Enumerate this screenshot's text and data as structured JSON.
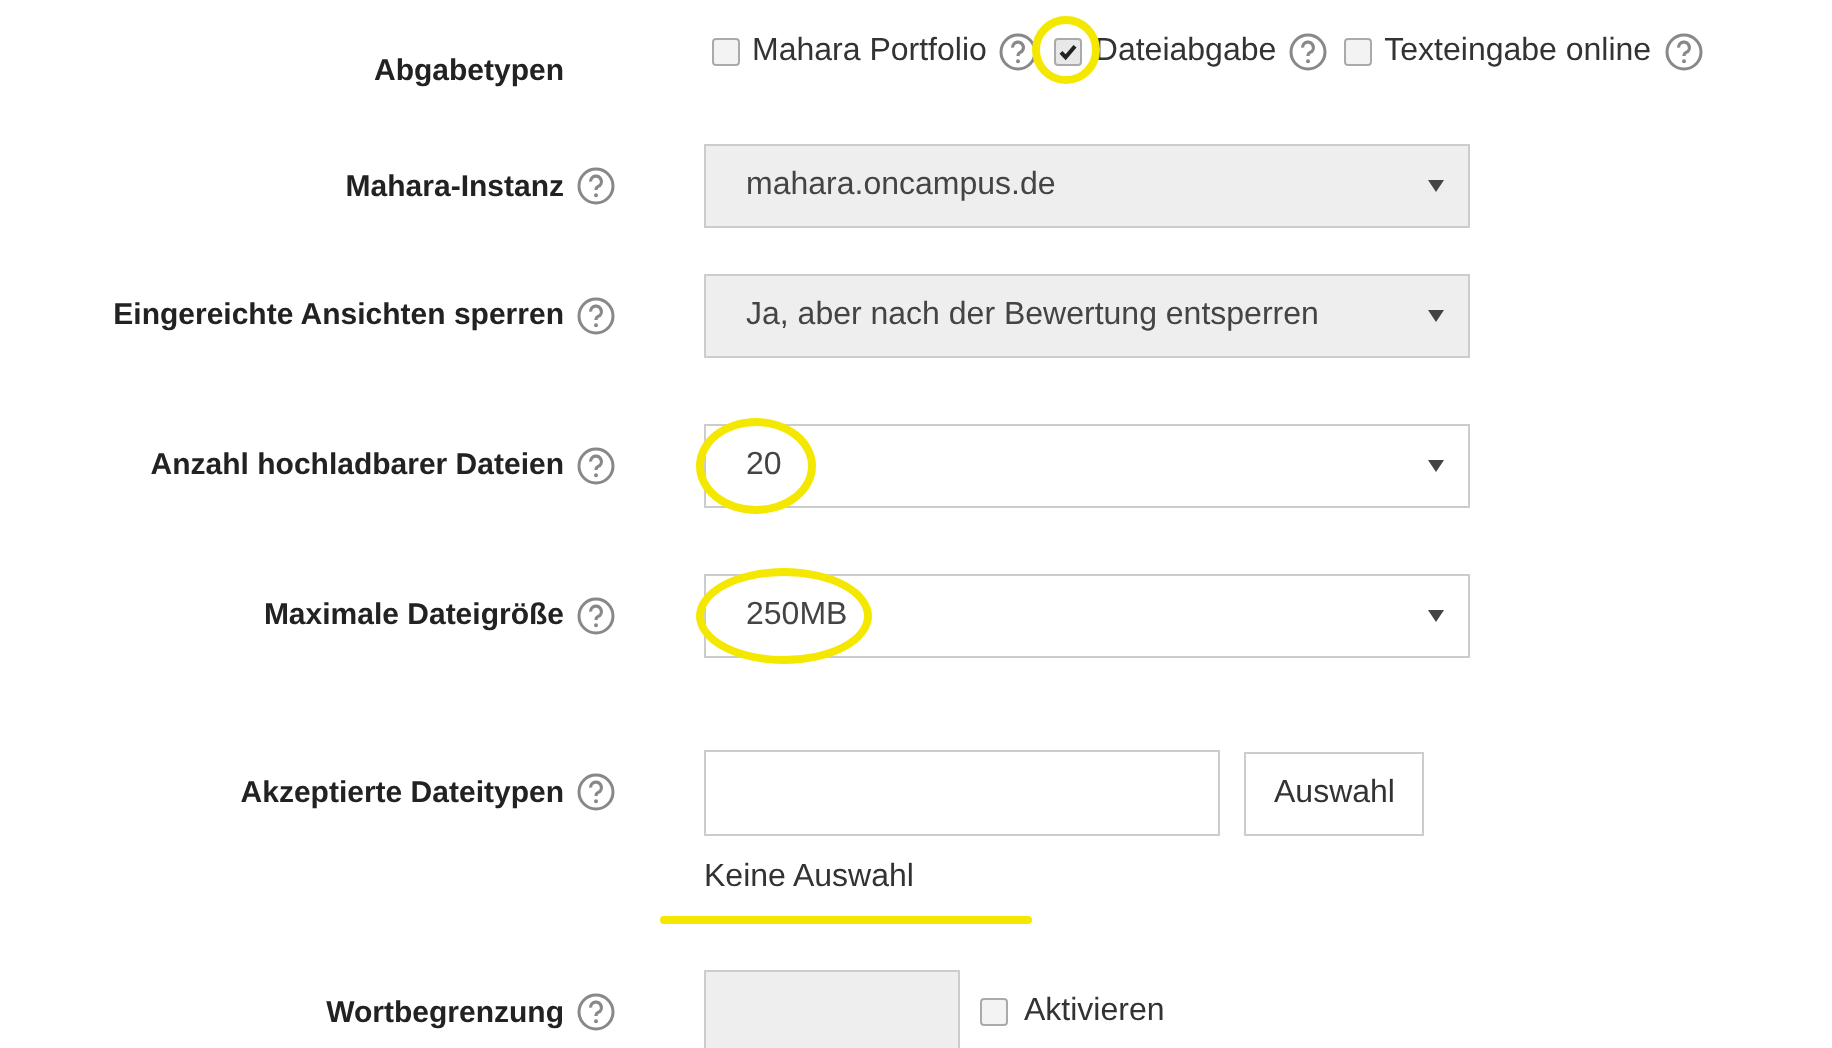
{
  "rows": [
    {
      "kind": "checkboxes",
      "label": "Abgabetypen",
      "help": false,
      "options": [
        {
          "label": "Mahara Portfolio",
          "checked": false,
          "highlighted": false
        },
        {
          "label": "Dateiabgabe",
          "checked": true,
          "highlighted": true
        },
        {
          "label": "Texteingabe online",
          "checked": false,
          "highlighted": false
        }
      ]
    },
    {
      "kind": "select",
      "label": "Mahara-Instanz",
      "help": true,
      "value": "mahara.oncampus.de",
      "disabled": true,
      "highlighted": false
    },
    {
      "kind": "select",
      "label": "Eingereichte Ansichten sperren",
      "help": true,
      "value": "Ja, aber nach der Bewertung entsperren",
      "disabled": true,
      "highlighted": false
    },
    {
      "kind": "select",
      "label": "Anzahl hochladbarer Dateien",
      "help": true,
      "value": "20",
      "disabled": false,
      "highlighted": true
    },
    {
      "kind": "select",
      "label": "Maximale Dateigröße",
      "help": true,
      "value": "250MB",
      "disabled": false,
      "highlighted": true
    },
    {
      "kind": "filetypes",
      "label": "Akzeptierte Dateitypen",
      "help": true,
      "button": "Auswahl",
      "note": "Keine Auswahl",
      "underlined": true
    },
    {
      "kind": "wordlimit",
      "label": "Wortbegrenzung",
      "help": true,
      "disabled": true,
      "checkbox": {
        "label": "Aktivieren",
        "checked": false
      }
    }
  ]
}
